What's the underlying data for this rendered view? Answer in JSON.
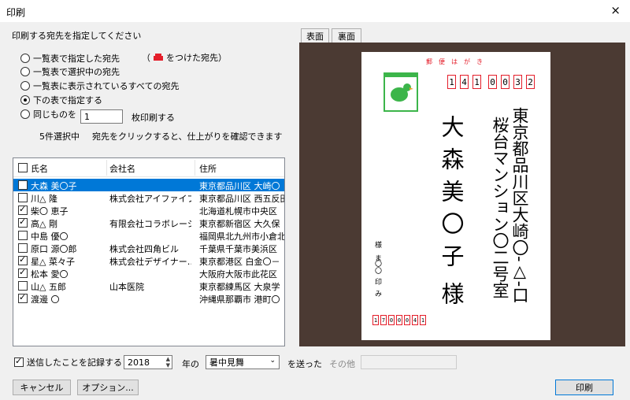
{
  "window": {
    "title": "印刷",
    "close_glyph": "×"
  },
  "section_label": "印刷する宛先を指定してください",
  "radios": [
    {
      "label": "一覧表で指定した宛先",
      "checked": false
    },
    {
      "label": "一覧表で選択中の宛先",
      "checked": false
    },
    {
      "label": "一覧表に表示されているすべての宛先",
      "checked": false
    },
    {
      "label": "下の表で指定する",
      "checked": true
    },
    {
      "label": "同じものを",
      "checked": false
    }
  ],
  "mark_note_open": "（",
  "mark_note": "をつけた宛先）",
  "copies": {
    "value": "1",
    "suffix": "枚印刷する"
  },
  "selection_status": "5件選択中",
  "selection_hint": "宛先をクリックすると、仕上がりを確認できます",
  "table": {
    "headers": [
      "氏名",
      "会社名",
      "住所"
    ],
    "rows": [
      {
        "checked": true,
        "name": "大森 美〇子",
        "company": "",
        "address": "東京都品川区 大崎〇",
        "selected": true
      },
      {
        "checked": false,
        "name": "川△ 隆",
        "company": "株式会社アイファイブ…",
        "address": "東京都品川区 西五反田",
        "selected": false
      },
      {
        "checked": true,
        "name": "柴〇 恵子",
        "company": "",
        "address": "北海道札幌市中央区",
        "selected": false
      },
      {
        "checked": true,
        "name": "高△ 剛",
        "company": "有限会社コラボレーシ…",
        "address": "東京都新宿区 大久保",
        "selected": false
      },
      {
        "checked": false,
        "name": "中島 優〇",
        "company": "",
        "address": "福岡県北九州市小倉北",
        "selected": false
      },
      {
        "checked": false,
        "name": "原口 源〇郎",
        "company": "株式会社四角ビル",
        "address": "千葉県千葉市美浜区",
        "selected": false
      },
      {
        "checked": true,
        "name": "星△ 菜々子",
        "company": "株式会社デザイナー…",
        "address": "東京都港区 白金〇－",
        "selected": false
      },
      {
        "checked": true,
        "name": "松本 愛〇",
        "company": "",
        "address": "大阪府大阪市此花区",
        "selected": false
      },
      {
        "checked": false,
        "name": "山△ 五郎",
        "company": "山本医院",
        "address": "東京都練馬区 大泉学",
        "selected": false
      },
      {
        "checked": true,
        "name": "渡邊 〇",
        "company": "",
        "address": "沖縄県那覇市 港町〇",
        "selected": false
      }
    ]
  },
  "record": {
    "checked": true,
    "label": "送信したことを記録する",
    "year": "2018",
    "year_suffix": "年の",
    "type": "暑中見舞",
    "sent_label": "を送った",
    "other_label": "その他"
  },
  "buttons": {
    "cancel": "キャンセル",
    "options": "オプション...",
    "print": "印刷"
  },
  "preview": {
    "tabs": [
      "表面",
      "裏面"
    ],
    "header_label": "郵便はがき",
    "postal_code": [
      "1",
      "4",
      "1",
      "0",
      "0",
      "3",
      "2"
    ],
    "address_line1": "東京都品川区大崎〇‐△‐口",
    "address_line2": "桜台マンション〇二号室",
    "recipient_name": "大森美〇子",
    "honorific": "様",
    "small_label_1": "様ま",
    "small_label_2": "〇〇",
    "small_label_3": "印み",
    "sender_postal": [
      "1",
      "7",
      "0",
      "0",
      "0",
      "4",
      "1"
    ],
    "colors": {
      "postcode_red": "#e41e2a",
      "stamp_green": "#3cb54a",
      "background": "#4b3a33"
    }
  }
}
